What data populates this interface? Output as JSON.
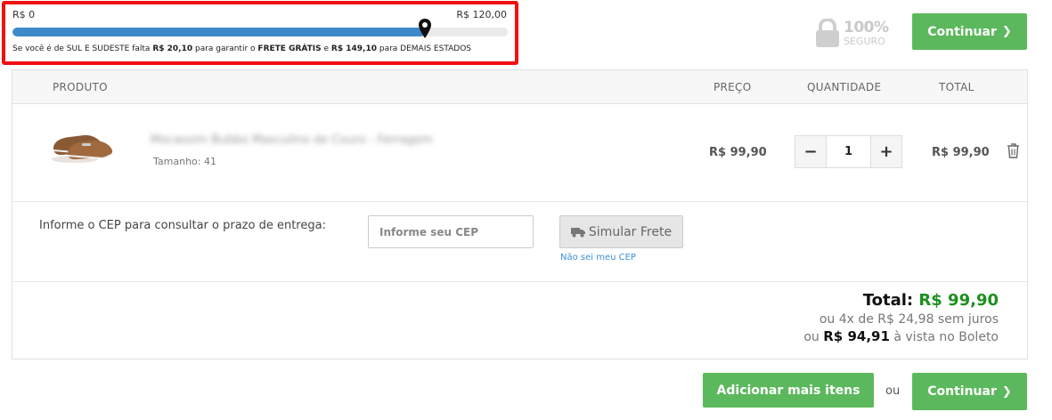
{
  "shipping_progress": {
    "min_label": "R$ 0",
    "max_label": "R$ 120,00",
    "progress": 0.8325,
    "msg_prefix": "Se você é de SUL E SUDESTE falta",
    "amount_south": "R$ 20,10",
    "msg_middle": "para garantir o",
    "free_shipping": "FRETE GRÁTIS",
    "msg_and": "e",
    "amount_others": "R$ 149,10",
    "msg_suffix": "para DEMAIS ESTADOS",
    "bar_color": "#3e89c9",
    "highlight_color": "#ee1111"
  },
  "secure_badge": {
    "percent": "100%",
    "text": "SEGURO",
    "icon": "lock-icon"
  },
  "buttons": {
    "continue": "Continuar",
    "add_more": "Adicionar mais itens",
    "or_text": "ou",
    "accent_color": "#5cb85c"
  },
  "cart": {
    "headers": {
      "product": "PRODUTO",
      "price": "PREÇO",
      "quantity": "QUANTIDADE",
      "total": "TOTAL"
    },
    "items": [
      {
        "name": "Mocassim Bubbo Masculino de Couro - Ferragem",
        "size": "Tamanho: 41",
        "price": "R$ 99,90",
        "quantity": "1",
        "total": "R$ 99,90",
        "image_icon": "shoe-icon"
      }
    ]
  },
  "shipping_calc": {
    "label": "Informe o CEP para consultar o prazo de entrega:",
    "placeholder": "Informe seu CEP",
    "button": "Simular Frete",
    "help_link": "Não sei meu CEP"
  },
  "totals": {
    "label": "Total:",
    "value": "R$ 99,90",
    "installments": "ou 4x de R$ 24,98 sem juros",
    "boleto_prefix": "ou",
    "boleto_value": "R$ 94,91",
    "boleto_suffix": "à vista no Boleto"
  }
}
